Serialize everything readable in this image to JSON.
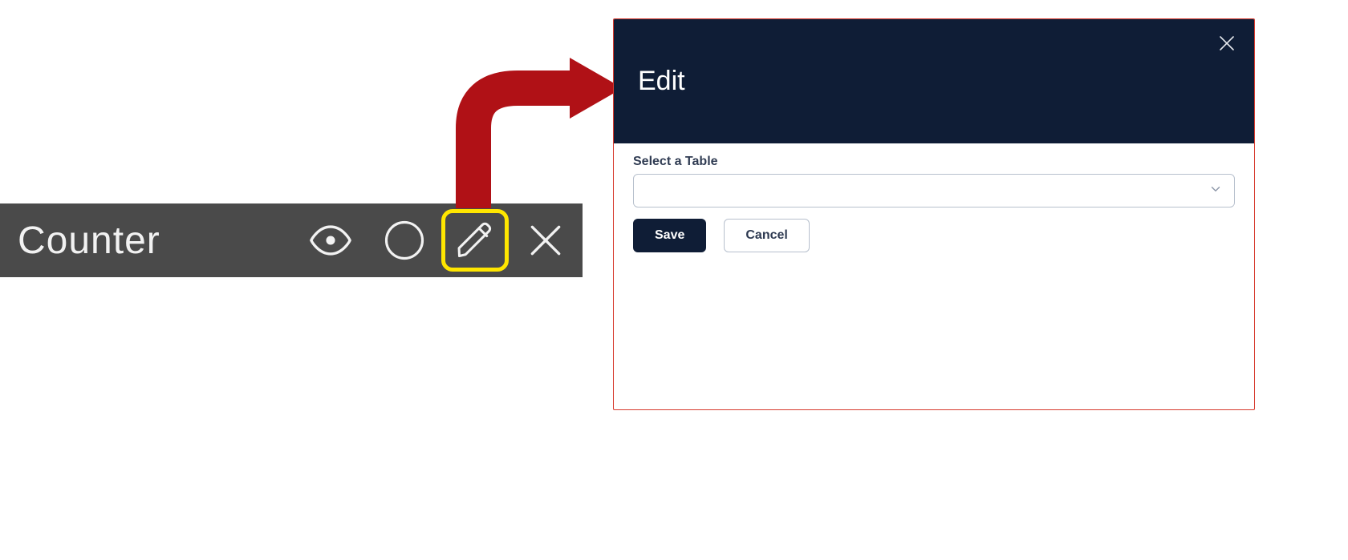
{
  "toolbar": {
    "title": "Counter",
    "icons": {
      "eye": "eye-icon",
      "circle": "circle-icon",
      "pencil": "pencil-icon",
      "close": "close-icon"
    }
  },
  "dialog": {
    "title": "Edit",
    "field_label": "Select a Table",
    "select_value": "",
    "save_label": "Save",
    "cancel_label": "Cancel"
  }
}
